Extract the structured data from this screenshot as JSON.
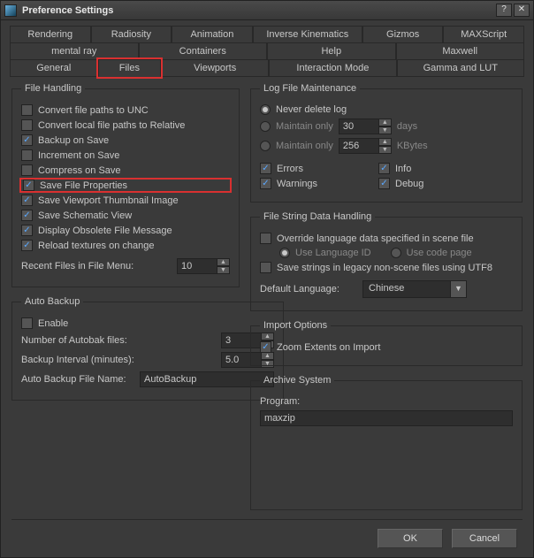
{
  "window": {
    "title": "Preference Settings"
  },
  "tabs": {
    "row1": [
      "Rendering",
      "Radiosity",
      "Animation",
      "Inverse Kinematics",
      "Gizmos",
      "MAXScript"
    ],
    "row2": [
      "mental ray",
      "Containers",
      "Help",
      "Maxwell"
    ],
    "row3": [
      "General",
      "Files",
      "Viewports",
      "Interaction Mode",
      "Gamma and LUT"
    ],
    "active": "Files"
  },
  "fileHandling": {
    "legend": "File Handling",
    "convertUNC": {
      "label": "Convert file paths to UNC",
      "checked": false
    },
    "convertRel": {
      "label": "Convert local file paths to Relative",
      "checked": false
    },
    "backupSave": {
      "label": "Backup on Save",
      "checked": true
    },
    "incrementSave": {
      "label": "Increment on Save",
      "checked": false
    },
    "compressSave": {
      "label": "Compress on Save",
      "checked": false
    },
    "saveFileProps": {
      "label": "Save File Properties",
      "checked": true
    },
    "saveThumb": {
      "label": "Save Viewport Thumbnail Image",
      "checked": true
    },
    "saveSchematic": {
      "label": "Save Schematic View",
      "checked": true
    },
    "displayObsolete": {
      "label": "Display Obsolete File Message",
      "checked": true
    },
    "reloadTex": {
      "label": "Reload textures on change",
      "checked": true
    },
    "recentLabel": "Recent Files in File Menu:",
    "recentValue": "10"
  },
  "autoBackup": {
    "legend": "Auto Backup",
    "enable": {
      "label": "Enable",
      "checked": false
    },
    "numFilesLabel": "Number of Autobak files:",
    "numFilesValue": "3",
    "intervalLabel": "Backup Interval (minutes):",
    "intervalValue": "5.0",
    "nameLabel": "Auto Backup File Name:",
    "nameValue": "AutoBackup"
  },
  "logMaint": {
    "legend": "Log File Maintenance",
    "neverDelete": "Never delete log",
    "maintainDays": "Maintain only",
    "daysValue": "30",
    "daysUnit": "days",
    "maintainKB": "Maintain only",
    "kbValue": "256",
    "kbUnit": "KBytes",
    "errors": {
      "label": "Errors",
      "checked": true
    },
    "info": {
      "label": "Info",
      "checked": true
    },
    "warnings": {
      "label": "Warnings",
      "checked": true
    },
    "debug": {
      "label": "Debug",
      "checked": true
    }
  },
  "stringHandling": {
    "legend": "File String Data Handling",
    "override": {
      "label": "Override language data specified in scene file",
      "checked": false
    },
    "useLangID": "Use Language ID",
    "useCodePage": "Use code page",
    "saveLegacy": {
      "label": "Save strings in legacy non-scene files using UTF8",
      "checked": false
    },
    "defaultLangLabel": "Default Language:",
    "defaultLangValue": "Chinese"
  },
  "importOpts": {
    "legend": "Import Options",
    "zoomExtents": {
      "label": "Zoom Extents on Import",
      "checked": true
    }
  },
  "archive": {
    "legend": "Archive System",
    "programLabel": "Program:",
    "programValue": "maxzip"
  },
  "footer": {
    "ok": "OK",
    "cancel": "Cancel"
  }
}
